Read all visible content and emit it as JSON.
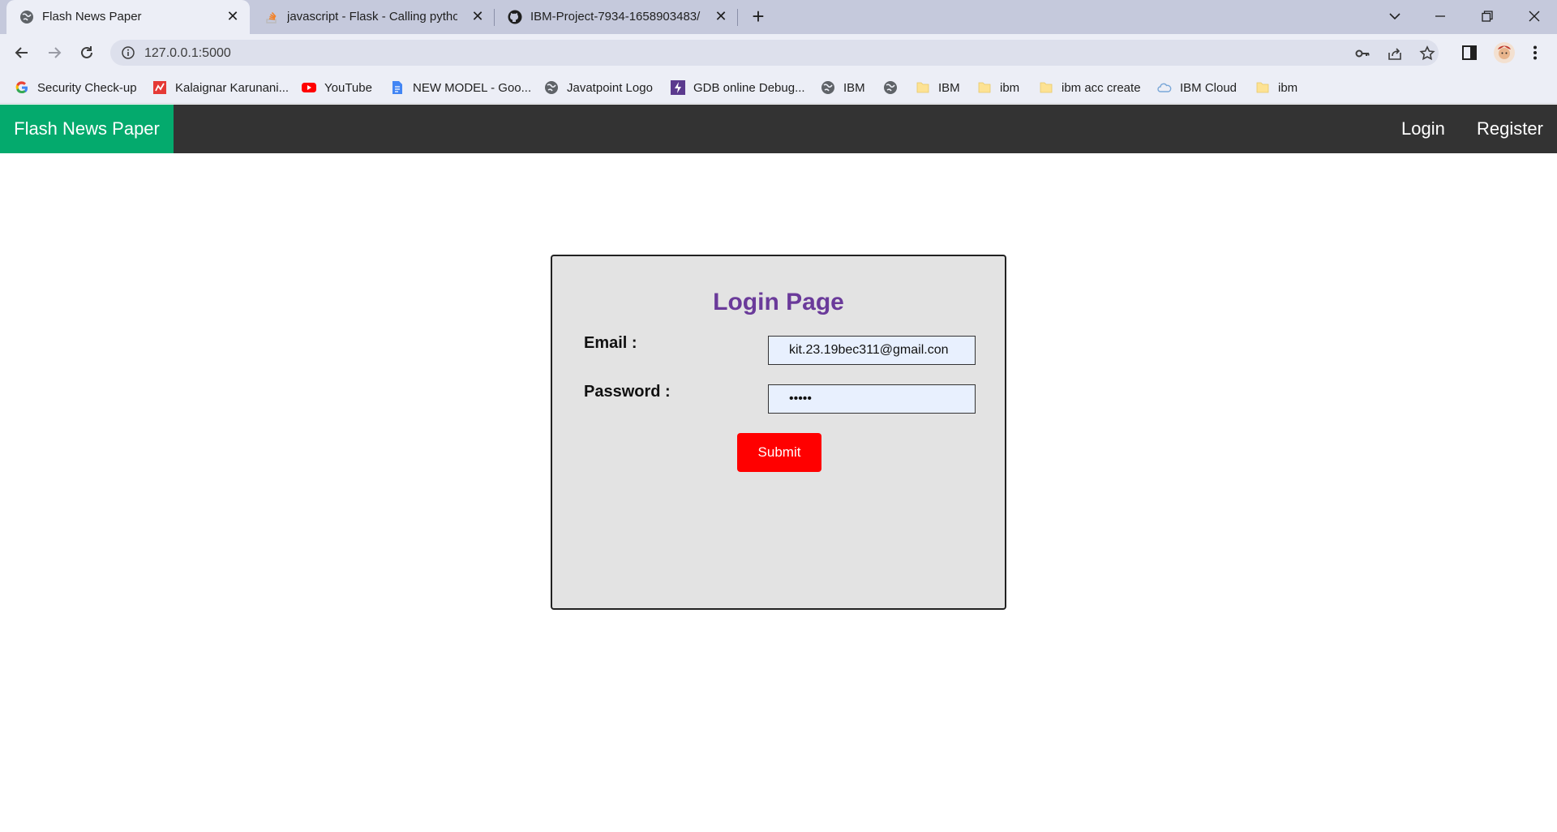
{
  "browser": {
    "tabs": [
      {
        "title": "Flash News Paper",
        "active": true
      },
      {
        "title": "javascript - Flask - Calling python",
        "active": false
      },
      {
        "title": "IBM-Project-7934-1658903483/i",
        "active": false
      }
    ],
    "url": "127.0.0.1:5000",
    "bookmarks": [
      {
        "label": "Security Check-up",
        "icon": "google-icon"
      },
      {
        "label": "Kalaignar Karunani...",
        "icon": "site-icon"
      },
      {
        "label": "YouTube",
        "icon": "youtube-icon"
      },
      {
        "label": "NEW MODEL - Goo...",
        "icon": "docs-icon"
      },
      {
        "label": "Javatpoint Logo",
        "icon": "globe-icon"
      },
      {
        "label": "GDB online Debug...",
        "icon": "gdb-icon"
      },
      {
        "label": "IBM",
        "icon": "globe-icon"
      },
      {
        "label": "",
        "icon": "globe-icon"
      },
      {
        "label": "IBM",
        "icon": "folder-icon"
      },
      {
        "label": "ibm",
        "icon": "folder-icon"
      },
      {
        "label": "ibm acc create",
        "icon": "folder-icon"
      },
      {
        "label": "IBM Cloud",
        "icon": "cloud-icon"
      },
      {
        "label": "ibm",
        "icon": "folder-icon"
      }
    ]
  },
  "nav": {
    "brand": "Flash News Paper",
    "login": "Login",
    "register": "Register"
  },
  "login_form": {
    "title": "Login Page",
    "email_label": "Email :",
    "email_value": "kit.23.19bec311@gmail.con",
    "password_label": "Password :",
    "password_value": "•••••",
    "submit_label": "Submit"
  },
  "colors": {
    "brand_green": "#04aa6d",
    "nav_dark": "#333333",
    "title_purple": "#6a3a9a",
    "submit_red": "#ff0000"
  }
}
